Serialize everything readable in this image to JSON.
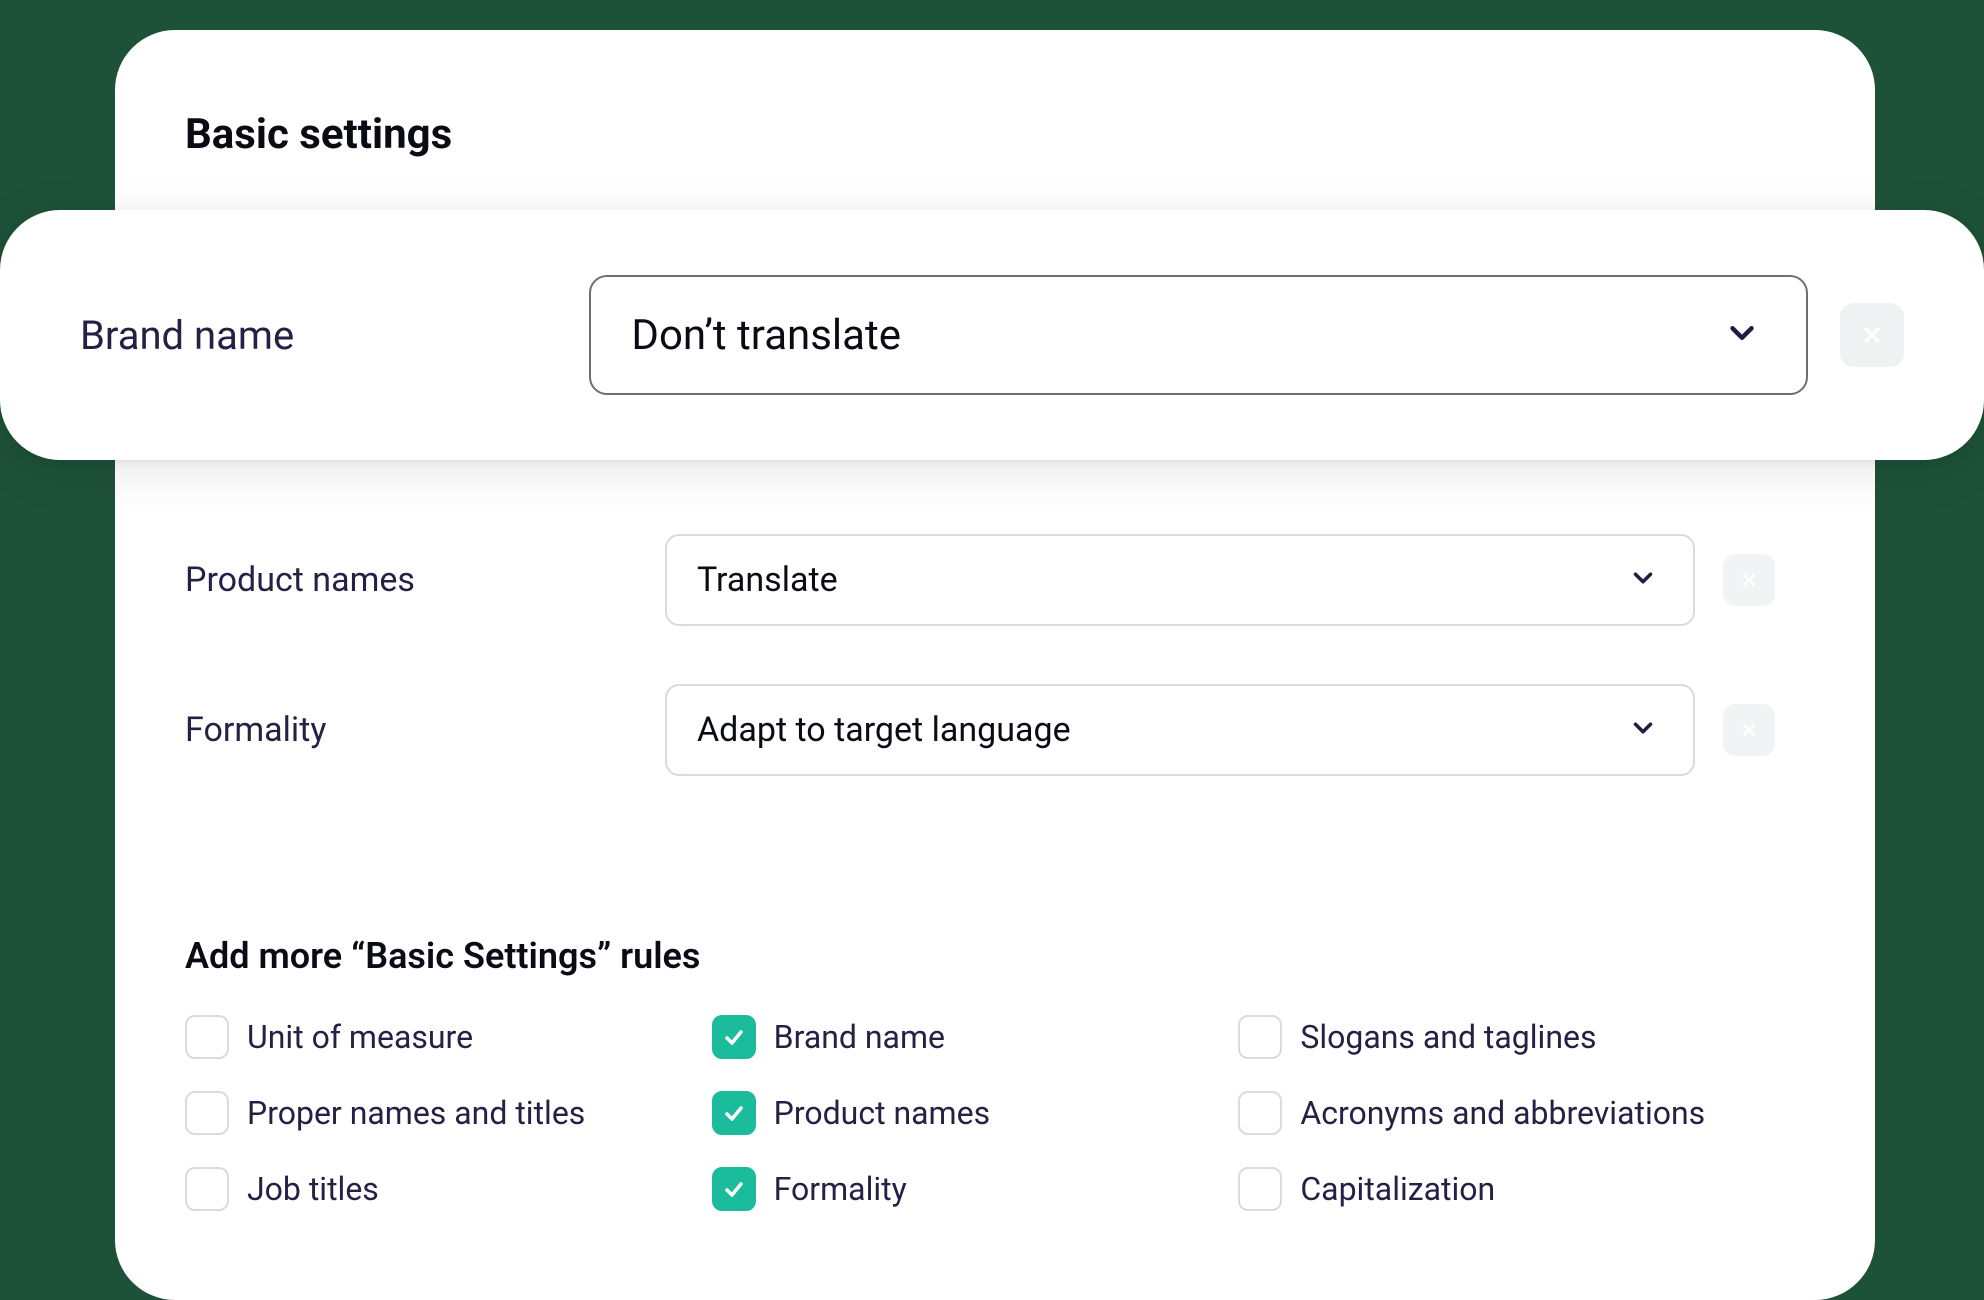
{
  "section_title": "Basic settings",
  "highlight_row": {
    "label": "Brand name",
    "value": "Don’t translate"
  },
  "rows": [
    {
      "label": "Product names",
      "value": "Translate"
    },
    {
      "label": "Formality",
      "value": "Adapt to target language"
    }
  ],
  "subsection_title": "Add more “Basic Settings” rules",
  "checkboxes": [
    {
      "label": "Unit of measure",
      "checked": false
    },
    {
      "label": "Brand name",
      "checked": true
    },
    {
      "label": "Slogans and taglines",
      "checked": false
    },
    {
      "label": "Proper names and titles",
      "checked": false
    },
    {
      "label": "Product names",
      "checked": true
    },
    {
      "label": "Acronyms and abbreviations",
      "checked": false
    },
    {
      "label": "Job titles",
      "checked": false
    },
    {
      "label": "Formality",
      "checked": true
    },
    {
      "label": "Capitalization",
      "checked": false
    }
  ]
}
